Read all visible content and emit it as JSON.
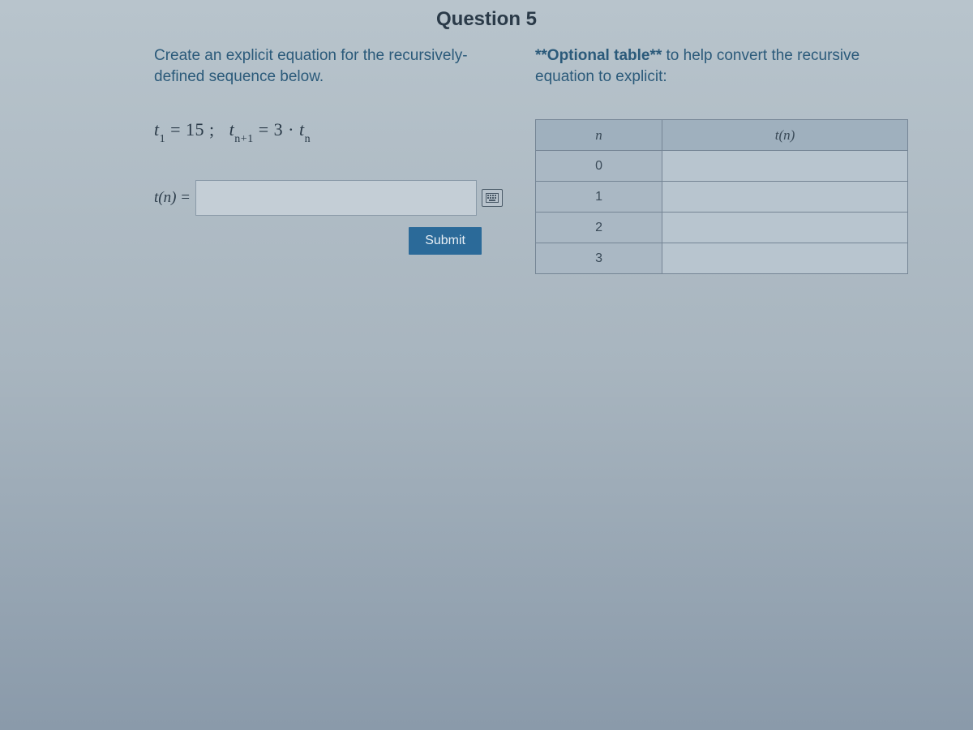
{
  "question": {
    "title": "Question 5",
    "prompt": "Create an explicit equation for the recursively-defined sequence below.",
    "equation": {
      "t1_label": "t",
      "t1_sub": "1",
      "t1_value": "15",
      "sep": ";",
      "tnext_label": "t",
      "tnext_sub": "n+1",
      "eq": "=",
      "coef": "3",
      "dot": "·",
      "tn_label": "t",
      "tn_sub": "n"
    },
    "answer_label": "t(n) =",
    "answer_value": "",
    "submit_label": "Submit"
  },
  "helper": {
    "intro_bold": "**Optional table**",
    "intro_rest": " to help convert the recursive equation to explicit:",
    "headers": {
      "n": "n",
      "tn": "t(n)"
    },
    "rows": [
      {
        "n": "0",
        "tn": ""
      },
      {
        "n": "1",
        "tn": ""
      },
      {
        "n": "2",
        "tn": ""
      },
      {
        "n": "3",
        "tn": ""
      }
    ]
  }
}
